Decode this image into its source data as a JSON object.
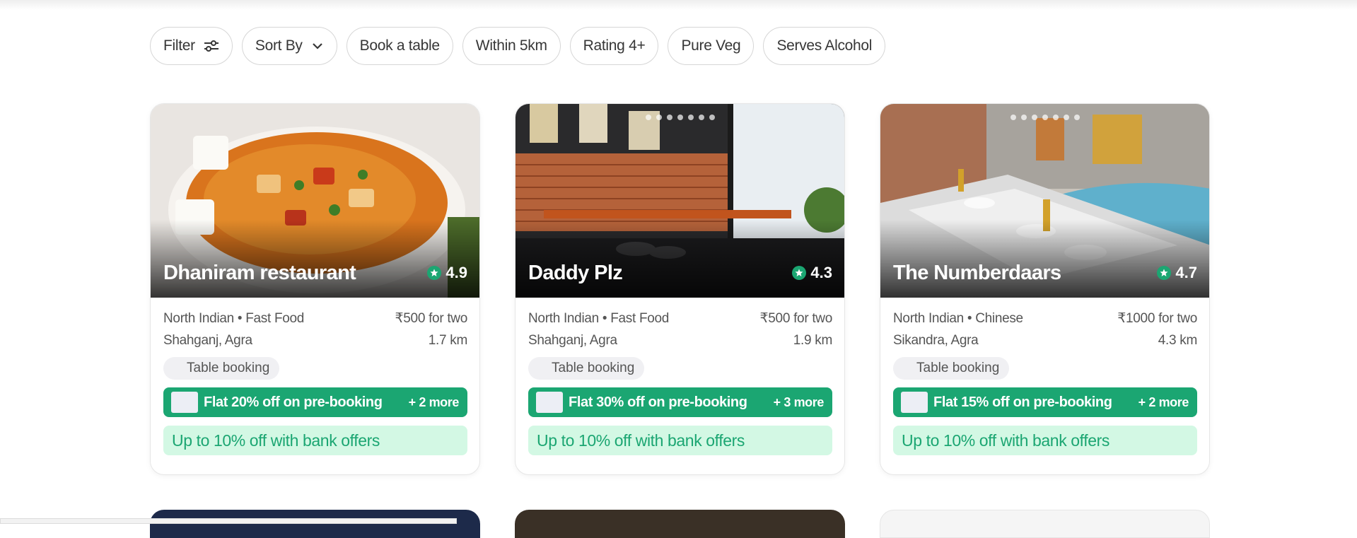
{
  "filters": [
    {
      "label": "Filter",
      "icon": "sliders-icon"
    },
    {
      "label": "Sort By",
      "icon": "chevron-down-icon"
    },
    {
      "label": "Book a table"
    },
    {
      "label": "Within 5km"
    },
    {
      "label": "Rating 4+"
    },
    {
      "label": "Pure Veg"
    },
    {
      "label": "Serves Alcohol"
    }
  ],
  "restaurants": [
    {
      "name": "Dhaniram restaurant",
      "rating": "4.9",
      "cuisine": "North Indian • Fast Food",
      "price": "₹500 for two",
      "location": "Shahganj, Agra",
      "distance": "1.7 km",
      "tag": "Table booking",
      "offer": "Flat 20% off on pre-booking",
      "more_offers": "+ 2 more",
      "bank_offer": "Up to 10% off with bank offers"
    },
    {
      "name": "Daddy Plz",
      "rating": "4.3",
      "cuisine": "North Indian • Fast Food",
      "price": "₹500 for two",
      "location": "Shahganj, Agra",
      "distance": "1.9 km",
      "tag": "Table booking",
      "offer": "Flat 30% off on pre-booking",
      "more_offers": "+ 3 more",
      "bank_offer": "Up to 10% off with bank offers"
    },
    {
      "name": "The Numberdaars",
      "rating": "4.7",
      "cuisine": "North Indian • Chinese",
      "price": "₹1000 for two",
      "location": "Sikandra, Agra",
      "distance": "4.3 km",
      "tag": "Table booking",
      "offer": "Flat 15% off on pre-booking",
      "more_offers": "+ 2 more",
      "bank_offer": "Up to 10% off with bank offers"
    }
  ],
  "colors": {
    "accent": "#1ba672",
    "bank_bg": "#d3f8e4",
    "chip_border": "#d6d6d6"
  }
}
